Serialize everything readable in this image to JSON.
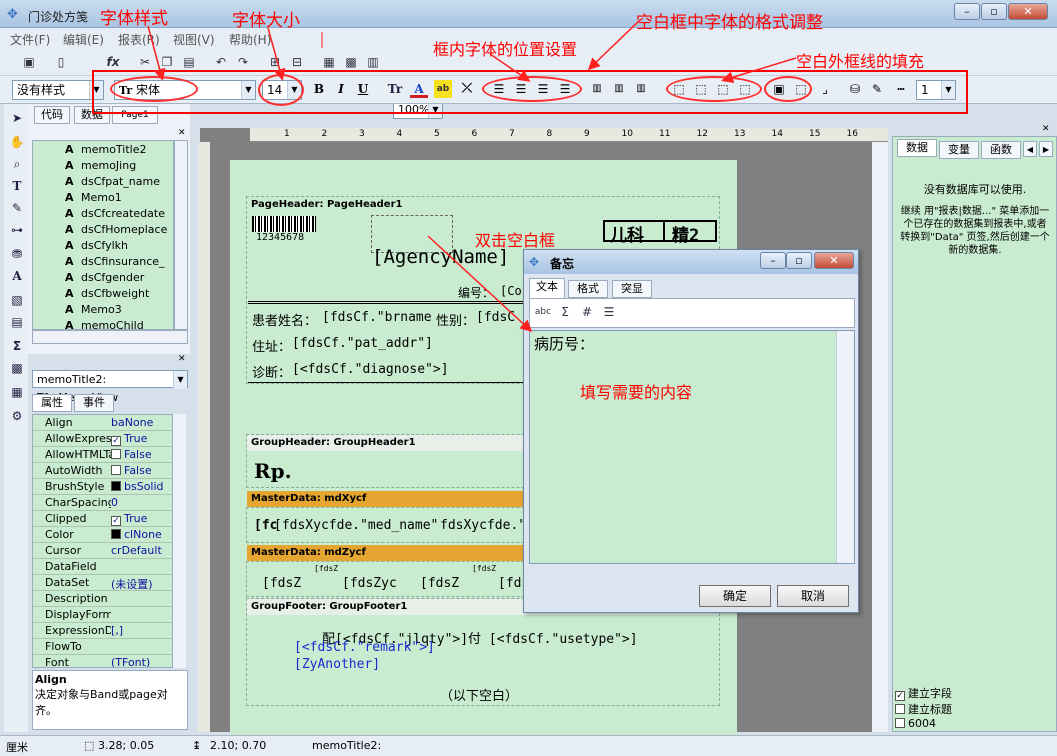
{
  "window": {
    "title": "门诊处方笺"
  },
  "menu": [
    "文件(F)",
    "编辑(E)",
    "报表(R)",
    "视图(V)",
    "帮助(H)"
  ],
  "toolbar": {
    "zoom": "100%"
  },
  "format_toolbar": {
    "style": "没有样式",
    "font": "宋体",
    "font_size": "14",
    "line_width": "1"
  },
  "annotations": {
    "font_style": "字体样式",
    "font_size": "字体大小",
    "format_adjust": "空白框中字体的格式调整",
    "position": "框内字体的位置设置",
    "border_fill": "空白外框线的填充",
    "double_click": "双击空白框",
    "fill_content": "填写需要的内容"
  },
  "left_tabs": [
    "代码",
    "数据",
    "Page1"
  ],
  "tree_items": [
    "memoTitle2",
    "memoJing",
    "dsCfpat_name",
    "Memo1",
    "dsCfcreatedate",
    "dsCfHomeplace",
    "dsCfylkh",
    "dsCfinsurance_",
    "dsCfgender",
    "dsCfbweight",
    "Memo3",
    "memoChild"
  ],
  "object_selector": "memoTitle2: TfrxMemoView",
  "prop_tabs": [
    "属性",
    "事件"
  ],
  "properties": [
    {
      "name": "Align",
      "value": "baNone",
      "check": ""
    },
    {
      "name": "AllowExpressi",
      "value": "True",
      "check": "on"
    },
    {
      "name": "AllowHTMLTa",
      "value": "False",
      "check": "off"
    },
    {
      "name": "AutoWidth",
      "value": "False",
      "check": "off"
    },
    {
      "name": "BrushStyle",
      "value": "bsSolid",
      "check": "black"
    },
    {
      "name": "CharSpacing",
      "value": "0",
      "check": ""
    },
    {
      "name": "Clipped",
      "value": "True",
      "check": "on"
    },
    {
      "name": "Color",
      "value": "clNone",
      "check": "black"
    },
    {
      "name": "Cursor",
      "value": "crDefault",
      "check": ""
    },
    {
      "name": "DataField",
      "value": "",
      "check": ""
    },
    {
      "name": "DataSet",
      "value": "(未设置)",
      "check": ""
    },
    {
      "name": "Description",
      "value": "",
      "check": ""
    },
    {
      "name": "DisplayForma",
      "value": "",
      "check": ""
    },
    {
      "name": "ExpressionDe",
      "value": "[,]",
      "check": ""
    },
    {
      "name": "FlowTo",
      "value": "",
      "check": ""
    },
    {
      "name": "Font",
      "value": "(TFont)",
      "check": ""
    }
  ],
  "prop_desc": {
    "title": "Align",
    "text": "决定对象与Band或page对齐。"
  },
  "ruler_numbers": [
    "1",
    "2",
    "3",
    "4",
    "5",
    "6",
    "7",
    "8",
    "9",
    "10",
    "11",
    "12",
    "13",
    "14",
    "15",
    "16"
  ],
  "bands": {
    "page_header": "PageHeader: PageHeader1",
    "group_header": "GroupHeader: GroupHeader1",
    "master1": "MasterData: mdXycf",
    "master2": "MasterData: mdZycf",
    "group_footer": "GroupFooter: GroupFooter1"
  },
  "report": {
    "barcode": "12345678",
    "dept": "儿科",
    "jing": "精2",
    "agency": "[AgencyName]",
    "bianhao": "编号：",
    "bianhao_val": "[Co",
    "patient_name": "患者姓名：",
    "patient_val": "[fdsCf.\"brname",
    "gender": "性别：",
    "gender_val": "[fdsC",
    "address": "住址：",
    "address_val": "[fdsCf.\"pat_addr\"]",
    "diag": "诊断：",
    "diag_val": "[<fdsCf.\"diagnose\">]",
    "rp": "Rp.",
    "med1a": "[fc",
    "med1b": "[fdsXycfde.\"med_name\"",
    "med1c": "fdsXycfde.\"",
    "med2a": "[fdsZ",
    "med2b": "[fdsZyc",
    "med2c": "[fdsZ",
    "med2d": "[fds",
    "small1": "[fdsZ",
    "small2": "[fdsZ",
    "footer1": "配[<fdsCf.\"jlqty\">]付 [<fdsCf.\"usetype\">]",
    "footer2": "[<fdsCf.\"remark\">]",
    "footer3": "[ZyAnother]",
    "footer4": "（以下空白）"
  },
  "dialog": {
    "title": "备忘",
    "tabs": [
      "文本",
      "格式",
      "突显"
    ],
    "content": "病历号：",
    "ok": "确定",
    "cancel": "取消"
  },
  "right_panel": {
    "tabs": [
      "数据",
      "变量",
      "函数"
    ],
    "message1": "没有数据库可以使用.",
    "message2": "继续 用\"报表|数据...\" 菜单添加一个已存在的数据集到报表中,或者转换到\"Data\" 页签,然后创建一个新的数据集.",
    "checks": [
      {
        "label": "建立字段",
        "checked": true
      },
      {
        "label": "建立标题",
        "checked": false
      },
      {
        "label": "6004",
        "checked": false
      }
    ]
  },
  "status": {
    "unit": "厘米",
    "pos": "3.28; 0.05",
    "size": "2.10; 0.70",
    "obj": "memoTitle2:"
  }
}
